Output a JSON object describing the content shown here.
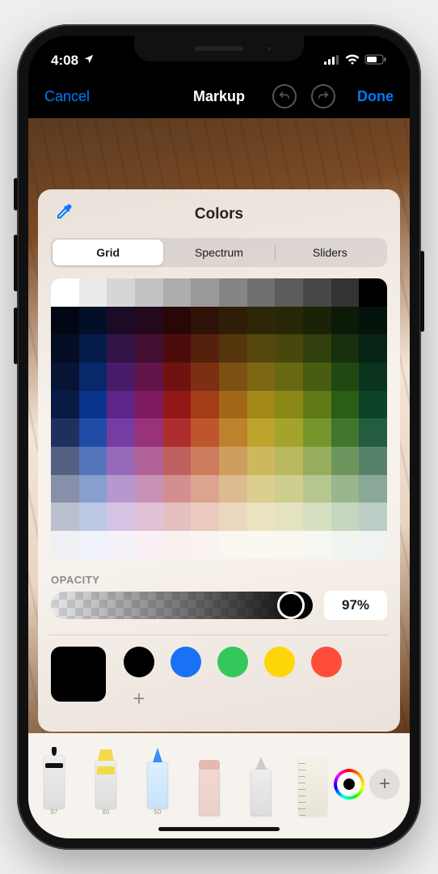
{
  "statusbar": {
    "time": "4:08",
    "location_icon": "location-arrow",
    "signal_icon": "cellular-bars",
    "wifi_icon": "wifi",
    "battery_icon": "battery"
  },
  "navbar": {
    "cancel": "Cancel",
    "title": "Markup",
    "done": "Done",
    "undo_icon": "undo",
    "redo_icon": "redo"
  },
  "sheet": {
    "title": "Colors",
    "eyedropper_icon": "eyedropper",
    "tabs": {
      "grid": "Grid",
      "spectrum": "Spectrum",
      "sliders": "Sliders"
    },
    "selected_tab": "Grid",
    "opacity_label": "OPACITY",
    "opacity_value": "97%",
    "opacity_fraction": 0.97,
    "grid": {
      "cols": 12,
      "rows": 10,
      "row0": [
        "#ffffff",
        "#ebebeb",
        "#d6d6d6",
        "#c2c2c2",
        "#adadad",
        "#999999",
        "#858585",
        "#707070",
        "#5c5c5c",
        "#474747",
        "#333333",
        "#000000"
      ],
      "base": [
        "#0a1d4d",
        "#0b3b9e",
        "#6a2a9c",
        "#8f1f6b",
        "#a61b1b",
        "#b8451a",
        "#b8751a",
        "#b89a1a",
        "#9c9a1a",
        "#6b8a1a",
        "#2f6a1a",
        "#0f4d2d"
      ]
    },
    "current_color": "#000000",
    "swatches": [
      "#000000",
      "#1b71f5",
      "#34c759",
      "#ffd60a",
      "#ff4d3a"
    ],
    "add_swatch_icon": "plus"
  },
  "toolbar": {
    "tools": [
      {
        "name": "pen",
        "label": "97"
      },
      {
        "name": "highlighter",
        "label": "80"
      },
      {
        "name": "pencil",
        "label": "50"
      },
      {
        "name": "eraser",
        "label": ""
      },
      {
        "name": "lasso",
        "label": ""
      },
      {
        "name": "ruler",
        "label": ""
      }
    ],
    "color_button_color": "#000000",
    "add_icon": "plus"
  }
}
